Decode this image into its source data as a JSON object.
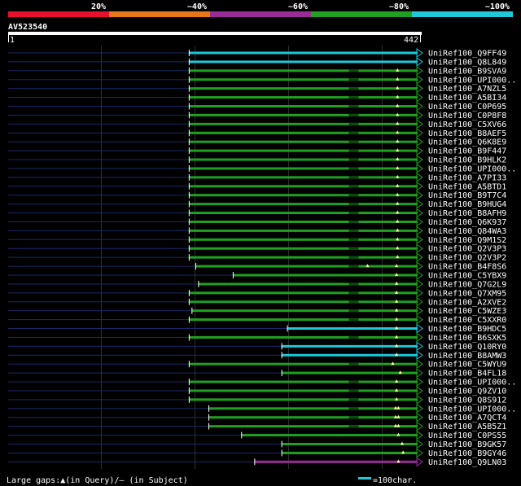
{
  "color_scale": {
    "segments": [
      {
        "label": "20%",
        "color": "#e8112d"
      },
      {
        "label": "~40%",
        "color": "#e8761a"
      },
      {
        "label": "~60%",
        "color": "#9a2c98"
      },
      {
        "label": "~80%",
        "color": "#20a020"
      },
      {
        "label": "~100%",
        "color": "#1ec8d8"
      }
    ]
  },
  "query": {
    "name": "AV523540",
    "start_label": "1",
    "end_label": "442",
    "length": 442
  },
  "hits": [
    {
      "name": "UniRef100_Q9FF49",
      "start": 194,
      "end": 442,
      "color": "#1ec8d8",
      "marks": []
    },
    {
      "name": "UniRef100_Q8L849",
      "start": 194,
      "end": 442,
      "color": "#1ec8d8",
      "marks": []
    },
    {
      "name": "UniRef100_B9SVA9",
      "start": 194,
      "end": 442,
      "color": "#20a020",
      "marks": [
        417
      ]
    },
    {
      "name": "UniRef100_UPI000..",
      "start": 194,
      "end": 442,
      "color": "#20a020",
      "marks": [
        417
      ]
    },
    {
      "name": "UniRef100_A7NZL5",
      "start": 194,
      "end": 442,
      "color": "#20a020",
      "marks": [
        417
      ]
    },
    {
      "name": "UniRef100_A5BI34",
      "start": 194,
      "end": 442,
      "color": "#20a020",
      "marks": [
        417
      ]
    },
    {
      "name": "UniRef100_C0P695",
      "start": 194,
      "end": 442,
      "color": "#20a020",
      "marks": [
        417
      ]
    },
    {
      "name": "UniRef100_C0P8F8",
      "start": 194,
      "end": 442,
      "color": "#20a020",
      "marks": [
        417
      ]
    },
    {
      "name": "UniRef100_C5XV66",
      "start": 194,
      "end": 442,
      "color": "#20a020",
      "marks": [
        417
      ]
    },
    {
      "name": "UniRef100_B8AEF5",
      "start": 194,
      "end": 442,
      "color": "#20a020",
      "marks": [
        417
      ]
    },
    {
      "name": "UniRef100_Q6K8E9",
      "start": 194,
      "end": 442,
      "color": "#20a020",
      "marks": [
        417
      ]
    },
    {
      "name": "UniRef100_B9F447",
      "start": 194,
      "end": 442,
      "color": "#20a020",
      "marks": [
        417
      ]
    },
    {
      "name": "UniRef100_B9HLK2",
      "start": 194,
      "end": 442,
      "color": "#20a020",
      "marks": [
        417
      ]
    },
    {
      "name": "UniRef100_UPI000..",
      "start": 194,
      "end": 442,
      "color": "#20a020",
      "marks": [
        417
      ]
    },
    {
      "name": "UniRef100_A7PI33",
      "start": 194,
      "end": 442,
      "color": "#20a020",
      "marks": [
        417
      ]
    },
    {
      "name": "UniRef100_A5BTD1",
      "start": 194,
      "end": 442,
      "color": "#20a020",
      "marks": [
        417
      ]
    },
    {
      "name": "UniRef100_B9T7C4",
      "start": 194,
      "end": 442,
      "color": "#20a020",
      "marks": [
        417
      ]
    },
    {
      "name": "UniRef100_B9HUG4",
      "start": 194,
      "end": 442,
      "color": "#20a020",
      "marks": [
        417
      ]
    },
    {
      "name": "UniRef100_B8AFH9",
      "start": 194,
      "end": 442,
      "color": "#20a020",
      "marks": [
        417
      ]
    },
    {
      "name": "UniRef100_Q6K937",
      "start": 194,
      "end": 442,
      "color": "#20a020",
      "marks": [
        417
      ]
    },
    {
      "name": "UniRef100_Q84WA3",
      "start": 194,
      "end": 442,
      "color": "#20a020",
      "marks": [
        417
      ]
    },
    {
      "name": "UniRef100_Q9M1S2",
      "start": 194,
      "end": 442,
      "color": "#20a020",
      "marks": [
        417
      ]
    },
    {
      "name": "UniRef100_Q2V3P3",
      "start": 194,
      "end": 442,
      "color": "#20a020",
      "marks": [
        417
      ]
    },
    {
      "name": "UniRef100_Q2V3P2",
      "start": 194,
      "end": 442,
      "color": "#20a020",
      "marks": [
        417
      ]
    },
    {
      "name": "UniRef100_B4F8S6",
      "start": 201,
      "end": 442,
      "color": "#20a020",
      "marks": [
        385,
        416
      ]
    },
    {
      "name": "UniRef100_C5YBX9",
      "start": 241,
      "end": 442,
      "color": "#20a020",
      "marks": [
        416
      ]
    },
    {
      "name": "UniRef100_Q7G2L9",
      "start": 204,
      "end": 442,
      "color": "#20a020",
      "marks": [
        416
      ]
    },
    {
      "name": "UniRef100_Q7XM95",
      "start": 194,
      "end": 442,
      "color": "#20a020",
      "marks": [
        416
      ]
    },
    {
      "name": "UniRef100_A2XVE2",
      "start": 194,
      "end": 442,
      "color": "#20a020",
      "marks": [
        416
      ]
    },
    {
      "name": "UniRef100_C5WZE3",
      "start": 197,
      "end": 442,
      "color": "#20a020",
      "marks": [
        416
      ]
    },
    {
      "name": "UniRef100_C5XXR0",
      "start": 194,
      "end": 442,
      "color": "#20a020",
      "marks": [
        416
      ]
    },
    {
      "name": "UniRef100_B9HDC5",
      "start": 299,
      "end": 442,
      "color": "#1ec8d8",
      "marks": [
        416
      ]
    },
    {
      "name": "UniRef100_B6SXK5",
      "start": 194,
      "end": 442,
      "color": "#20a020",
      "marks": [
        416
      ]
    },
    {
      "name": "UniRef100_Q10RY0",
      "start": 293,
      "end": 442,
      "color": "#1ec8d8",
      "marks": [
        416
      ]
    },
    {
      "name": "UniRef100_B8AMW3",
      "start": 293,
      "end": 442,
      "color": "#1ec8d8",
      "marks": [
        416
      ]
    },
    {
      "name": "UniRef100_C5WYU9",
      "start": 194,
      "end": 442,
      "color": "#20a020",
      "marks": [
        412
      ]
    },
    {
      "name": "UniRef100_B4FL18",
      "start": 293,
      "end": 442,
      "color": "#20a020",
      "marks": [
        420
      ]
    },
    {
      "name": "UniRef100_UPI000..",
      "start": 194,
      "end": 442,
      "color": "#20a020",
      "marks": [
        416
      ]
    },
    {
      "name": "UniRef100_Q9ZV10",
      "start": 194,
      "end": 442,
      "color": "#20a020",
      "marks": [
        416
      ]
    },
    {
      "name": "UniRef100_Q8S912",
      "start": 194,
      "end": 442,
      "color": "#20a020",
      "marks": [
        416
      ]
    },
    {
      "name": "UniRef100_UPI000..",
      "start": 215,
      "end": 442,
      "color": "#20a020",
      "marks": [
        415,
        418
      ]
    },
    {
      "name": "UniRef100_A7QCT4",
      "start": 215,
      "end": 442,
      "color": "#20a020",
      "marks": [
        415,
        418
      ]
    },
    {
      "name": "UniRef100_A5B5Z1",
      "start": 215,
      "end": 442,
      "color": "#20a020",
      "marks": [
        415,
        418
      ]
    },
    {
      "name": "UniRef100_C0PS55",
      "start": 250,
      "end": 442,
      "color": "#20a020",
      "marks": [
        418
      ]
    },
    {
      "name": "UniRef100_B9GK57",
      "start": 293,
      "end": 442,
      "color": "#20a020",
      "marks": [
        422
      ]
    },
    {
      "name": "UniRef100_B9GY46",
      "start": 293,
      "end": 442,
      "color": "#20a020",
      "marks": [
        423
      ]
    },
    {
      "name": "UniRef100_Q9LN03",
      "start": 264,
      "end": 442,
      "color": "#9a2c98",
      "marks": [
        418
      ]
    }
  ],
  "legend": {
    "gaps_text": "Large gaps:▲(in Query)/– (in Subject)",
    "scale_text": "=100char.",
    "scale_color": "#1ec8d8"
  }
}
